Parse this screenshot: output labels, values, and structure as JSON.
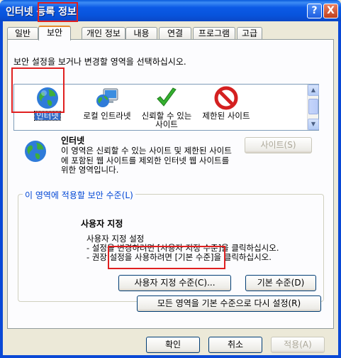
{
  "window": {
    "title": "인터넷 등록 정보",
    "help_label": "?",
    "close_label": "X"
  },
  "tabs": [
    {
      "label": "일반"
    },
    {
      "label": "보안"
    },
    {
      "label": "개인 정보"
    },
    {
      "label": "내용"
    },
    {
      "label": "연결"
    },
    {
      "label": "프로그램"
    },
    {
      "label": "고급"
    }
  ],
  "security": {
    "zone_prompt": "보안 설정을 보거나 변경할 영역을 선택하십시오.",
    "zones": [
      {
        "label": "인터넷",
        "icon": "globe-icon"
      },
      {
        "label": "로컬 인트라넷",
        "icon": "computer-globe-icon"
      },
      {
        "label": "신뢰할 수 있는 사이트",
        "icon": "checkmark-icon"
      },
      {
        "label": "제한된 사이트",
        "icon": "restricted-icon"
      }
    ],
    "selected_zone": {
      "name": "인터넷",
      "description": "이 영역은 신뢰할 수 있는 사이트 및 제한된 사이트에 포함된 웹 사이트를 제외한 인터넷 웹 사이트를 위한 영역입니다."
    },
    "sites_button": "사이트(S)",
    "level_group_label": "이 영역에 적용할 보안 수준(L)",
    "level_title": "사용자 지정",
    "level_desc_lines": [
      "사용자 지정 설정",
      "- 설정을 변경하려면 [사용자 지정 수준]을 클릭하십시오.",
      "- 권장 설정을 사용하려면 [기본 수준]을 클릭하십시오."
    ],
    "custom_level_button": "사용자 지정 수준(C)...",
    "default_level_button": "기본 수준(D)",
    "reset_all_button": "모든 영역을 기본 수준으로 다시 설정(R)"
  },
  "footer": {
    "ok_button": "확인",
    "cancel_button": "취소",
    "apply_button": "적용(A)"
  },
  "colors": {
    "titlebar": "#0a5bdc",
    "highlight": "#e02020",
    "legend_text": "#0046d5",
    "selection": "#316ac5"
  }
}
